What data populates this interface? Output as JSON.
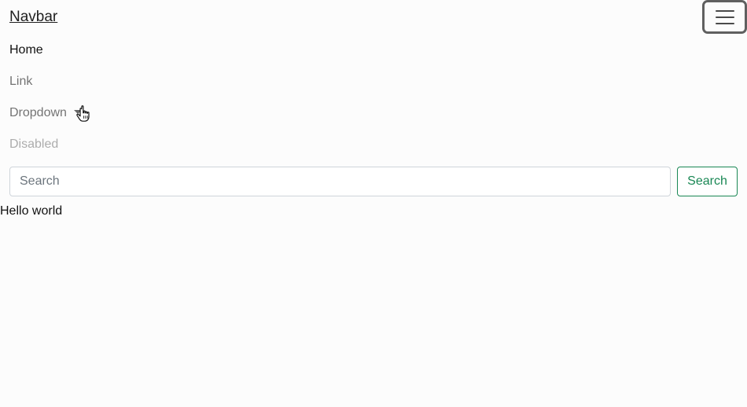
{
  "navbar": {
    "brand": "Navbar",
    "toggler_icon": "hamburger-icon",
    "items": [
      {
        "label": "Home",
        "state": "active"
      },
      {
        "label": "Link",
        "state": "normal"
      },
      {
        "label": "Dropdown",
        "state": "normal",
        "icon": "chevron-down-icon"
      },
      {
        "label": "Disabled",
        "state": "disabled"
      }
    ]
  },
  "search": {
    "placeholder": "Search",
    "value": "",
    "button_label": "Search"
  },
  "content": {
    "text": "Hello world"
  },
  "colors": {
    "success": "#198754",
    "background": "#fcfcfc"
  }
}
